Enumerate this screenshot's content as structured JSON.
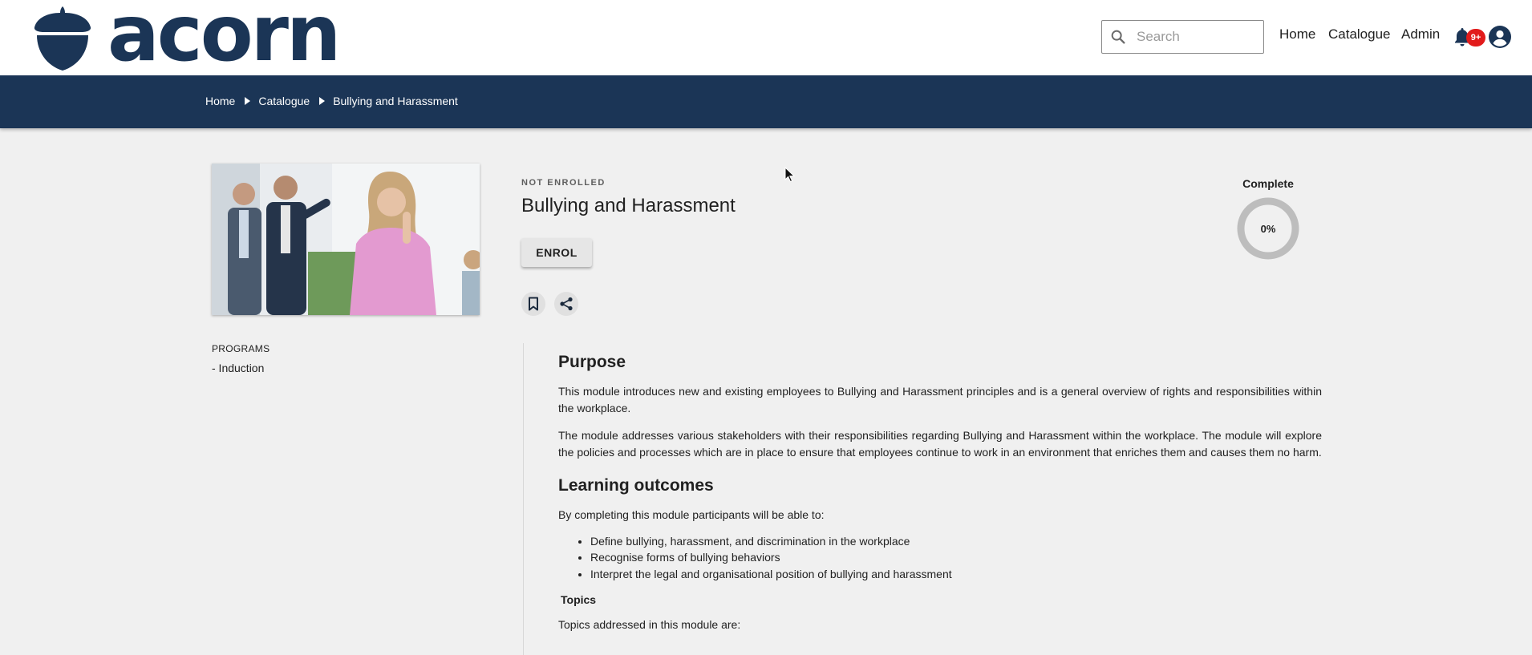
{
  "brand": {
    "name": "acorn",
    "color": "#1b3556"
  },
  "header": {
    "search_placeholder": "Search",
    "nav": [
      "Home",
      "Catalogue",
      "Admin"
    ],
    "notifications_badge": "9+",
    "badge_color": "#e21b1b"
  },
  "breadcrumb": [
    "Home",
    "Catalogue",
    "Bullying and Harassment"
  ],
  "module": {
    "status": "NOT ENROLLED",
    "title": "Bullying and Harassment",
    "enrol_label": "ENROL",
    "progress_label": "Complete",
    "progress_text": "0%",
    "progress_value": 0
  },
  "programs": {
    "label": "PROGRAMS",
    "items": [
      "- Induction"
    ]
  },
  "description": {
    "purpose_heading": "Purpose",
    "purpose_p1": "This module introduces new and existing employees to Bullying and Harassment principles and is a general overview of rights and responsibilities within the workplace.",
    "purpose_p2": "The module addresses various stakeholders with their responsibilities regarding Bullying and Harassment within the workplace. The module will explore the policies and processes which are in place to ensure that employees continue to work in an environment that enriches them and causes them no harm.",
    "outcomes_heading": "Learning outcomes",
    "outcomes_intro": "By completing this module participants will be able to:",
    "outcomes": [
      "Define bullying, harassment, and discrimination in the workplace",
      "Recognise forms of bullying behaviors",
      "Interpret the legal and organisational position of bullying and harassment"
    ],
    "topics_heading": "Topics",
    "topics_intro": "Topics addressed in this module are:"
  }
}
